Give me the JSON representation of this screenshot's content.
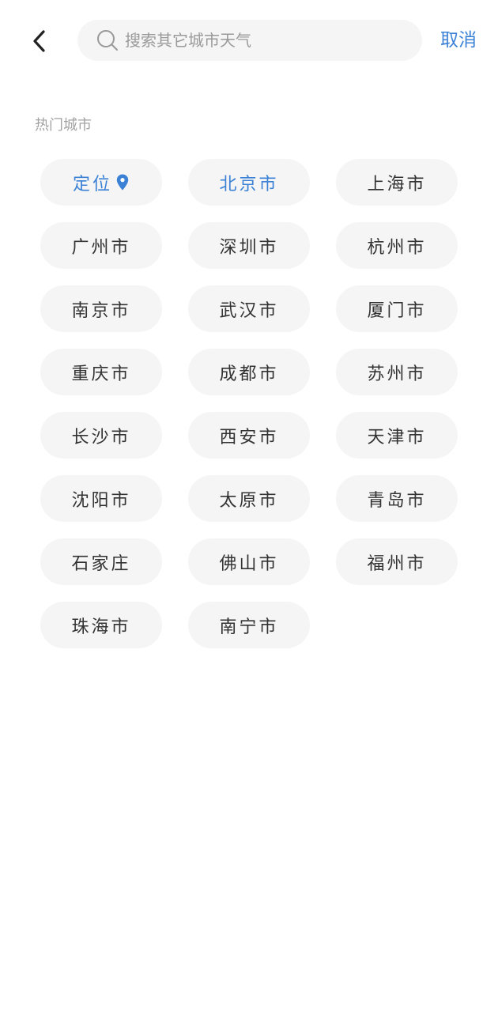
{
  "header": {
    "back_icon": "chevron-left-icon",
    "search": {
      "placeholder": "搜索其它城市天气",
      "value": "",
      "icon": "search-icon"
    },
    "cancel_label": "取消"
  },
  "hot_cities": {
    "title": "热门城市",
    "location_chip": {
      "label": "定位",
      "icon": "location-pin-icon"
    },
    "cities": [
      "北京市",
      "上海市",
      "广州市",
      "深圳市",
      "杭州市",
      "南京市",
      "武汉市",
      "厦门市",
      "重庆市",
      "成都市",
      "苏州市",
      "长沙市",
      "西安市",
      "天津市",
      "沈阳市",
      "太原市",
      "青岛市",
      "石家庄",
      "佛山市",
      "福州市",
      "珠海市",
      "南宁市"
    ],
    "selected_city": "北京市"
  },
  "colors": {
    "accent": "#3b82d6",
    "chip_bg": "#f5f5f5",
    "text": "#333333",
    "muted": "#a2a2a2"
  }
}
